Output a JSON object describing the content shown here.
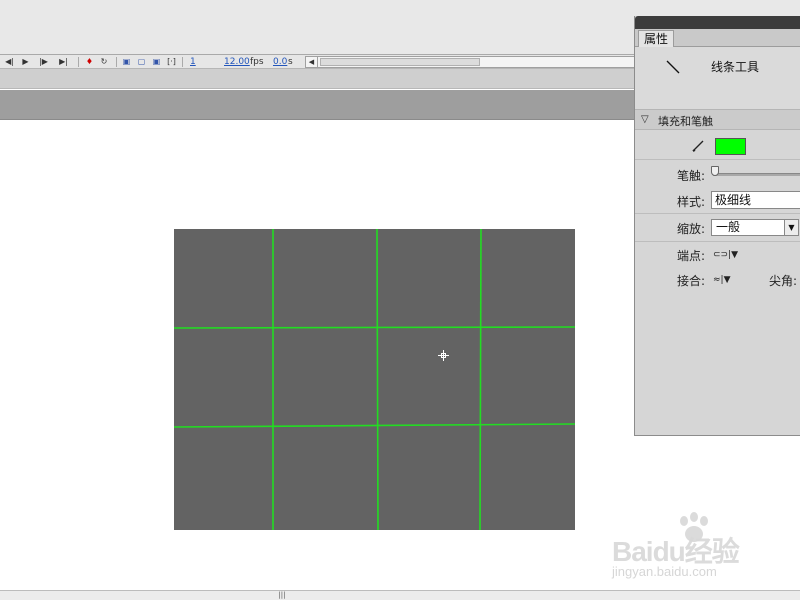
{
  "timeline": {
    "buttons": [
      "first-frame",
      "play",
      "next-frame",
      "last-frame"
    ],
    "frame_number": "1",
    "fps_value": "12.00",
    "fps_unit": "fps",
    "time_value": "0.0",
    "time_unit": "s"
  },
  "properties_panel": {
    "tab_label": "属性",
    "tool_name": "线条工具",
    "section_title": "填充和笔触",
    "stroke_color": "#00ff00",
    "stroke_label": "笔触:",
    "style_label": "样式:",
    "style_value": "极细线",
    "scale_label": "缩放:",
    "scale_value": "一般",
    "cap_label": "端点:",
    "join_label": "接合:",
    "miter_label": "尖角:"
  },
  "stage": {
    "background_color": "#636363",
    "grid_line_color": "#22dd22",
    "grid_columns": 4,
    "grid_rows": 3
  },
  "watermark": {
    "logo_text": "Baidu经验",
    "url_text": "jingyan.baidu.com"
  },
  "bottom_scrollbar": {
    "grip_glyph": "|||"
  }
}
